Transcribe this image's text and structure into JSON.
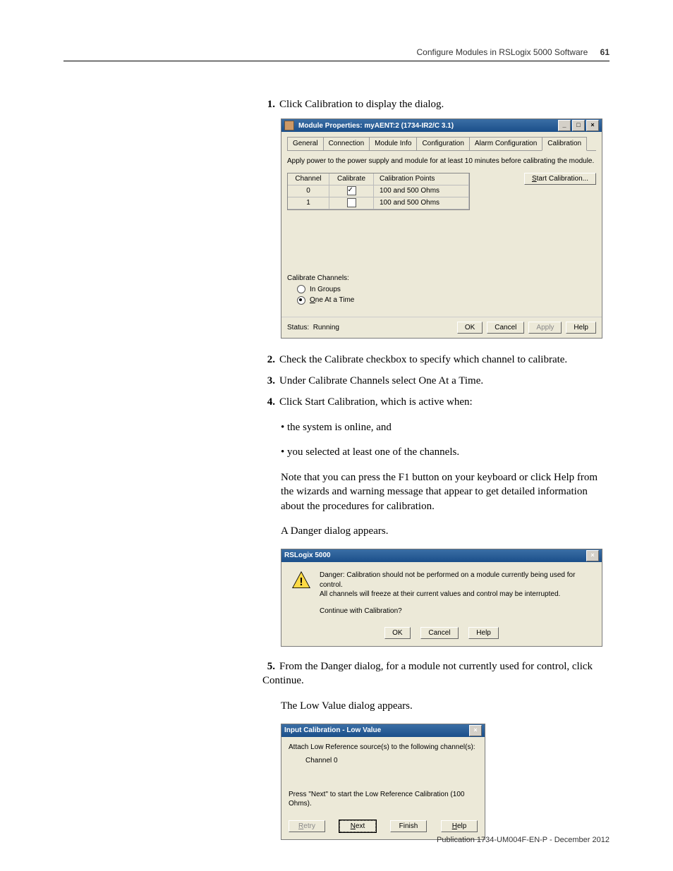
{
  "header": {
    "chapter": "Configure Modules in RSLogix 5000 Software",
    "page_num": "61"
  },
  "steps": {
    "s1": "Click Calibration to display the dialog.",
    "s2": "Check the Calibrate checkbox to specify which channel to calibrate.",
    "s3": "Under Calibrate Channels select One At a Time.",
    "s4": "Click Start Calibration, which is active when:",
    "s4_b1": "the system is online, and",
    "s4_b2": "you selected at least one of the channels.",
    "s4_note": "Note that you can press the F1 button on your keyboard or click Help from the wizards and warning message that appear to get detailed information about the procedures for calibration.",
    "s4_after": "A Danger dialog appears.",
    "s5": "From the Danger dialog, for a module not currently used for control, click Continue.",
    "s5_after": "The Low Value dialog appears."
  },
  "dlg1": {
    "title": "Module Properties: myAENT:2 (1734-IR2/C 3.1)",
    "tabs": [
      "General",
      "Connection",
      "Module Info",
      "Configuration",
      "Alarm Configuration",
      "Calibration"
    ],
    "note": "Apply power to the power supply and module for at least 10 minutes before calibrating the module.",
    "grid": {
      "headers": [
        "Channel",
        "Calibrate",
        "Calibration Points"
      ],
      "rows": [
        {
          "chan": "0",
          "checked": true,
          "pts": "100 and 500 Ohms"
        },
        {
          "chan": "1",
          "checked": false,
          "pts": "100 and 500 Ohms"
        }
      ]
    },
    "start_btn": "Start Calibration...",
    "calib_channels_label": "Calibrate Channels:",
    "radio1": "In Groups",
    "radio2": "One At a Time",
    "status_label": "Status:",
    "status_value": "Running",
    "ok": "OK",
    "cancel": "Cancel",
    "apply": "Apply",
    "help": "Help"
  },
  "dlg2": {
    "title": "RSLogix 5000",
    "line1": "Danger: Calibration should not be performed on a module currently being used for control.",
    "line2": "All channels will freeze at their current values and control may be interrupted.",
    "line3": "Continue with Calibration?",
    "ok": "OK",
    "cancel": "Cancel",
    "help": "Help"
  },
  "dlg3": {
    "title": "Input Calibration - Low Value",
    "line1": "Attach Low Reference source(s) to the following channel(s):",
    "line2": "Channel 0",
    "line3": "Press \"Next\" to start the Low Reference Calibration (100 Ohms).",
    "retry": "Retry",
    "next": "Next",
    "finish": "Finish",
    "help": "Help"
  },
  "footer": "Publication 1734-UM004F-EN-P - December 2012"
}
